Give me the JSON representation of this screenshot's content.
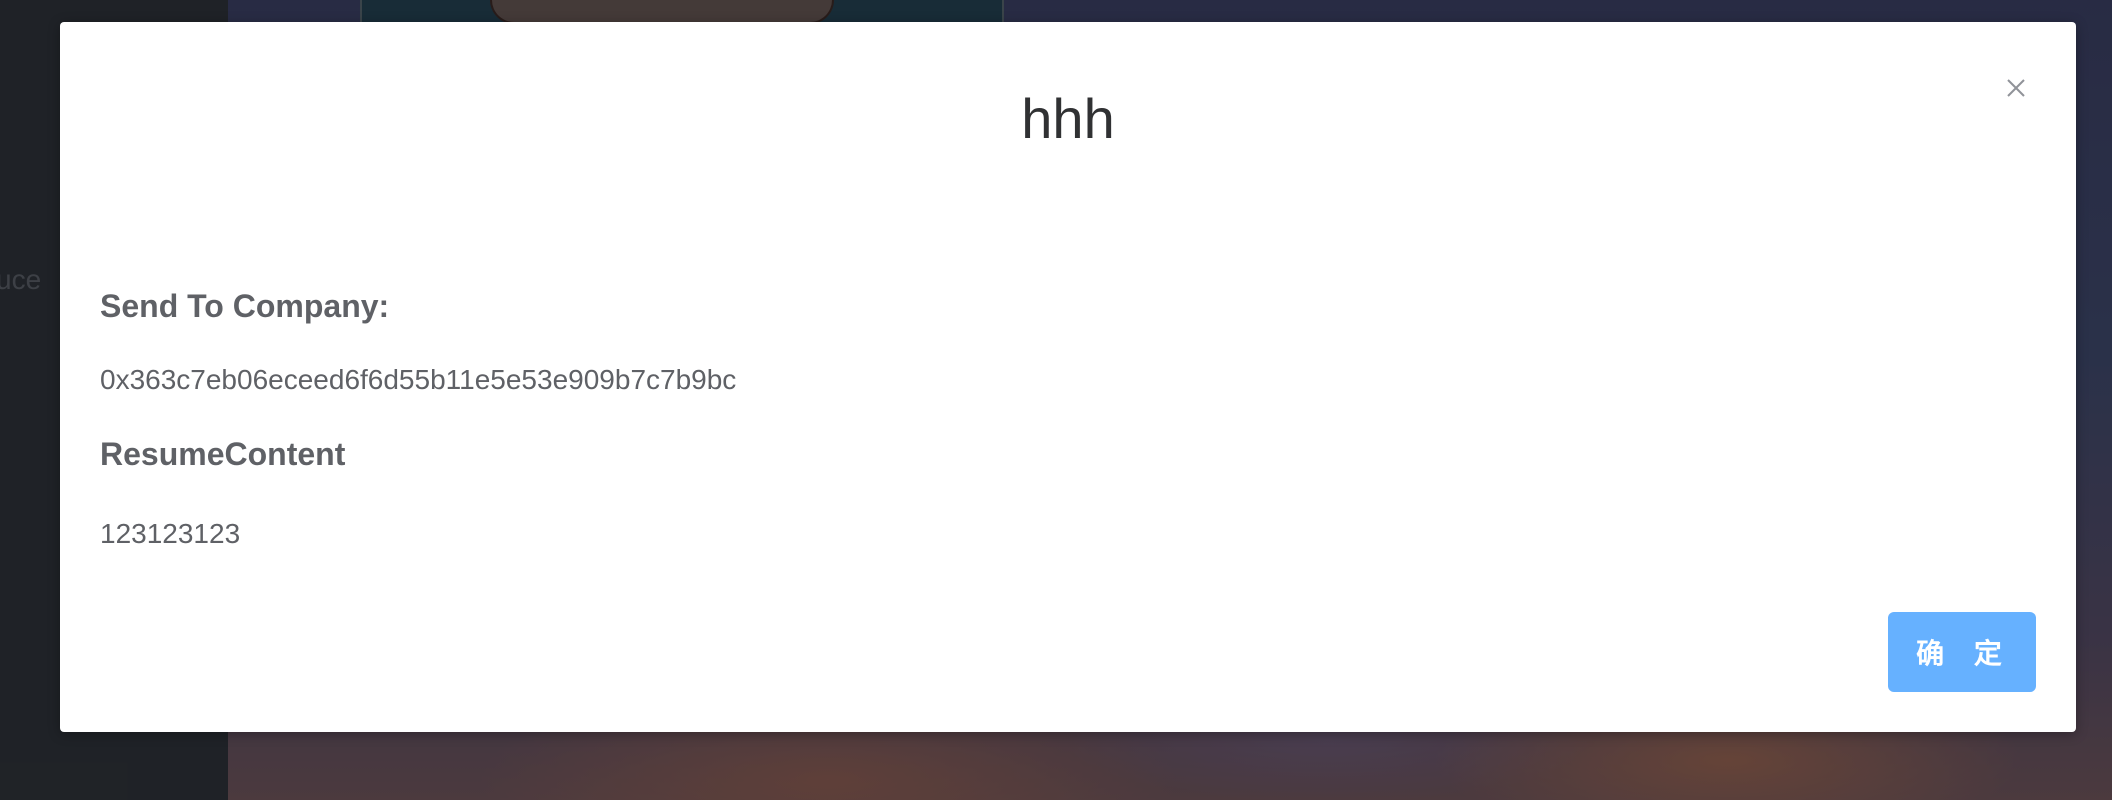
{
  "background": {
    "sidebar_partial_label": "uce"
  },
  "dialog": {
    "title": "hhh",
    "close_icon": "close-icon",
    "fields": [
      {
        "label": "Send To Company:",
        "value": "0x363c7eb06eceed6f6d55b11e5e53e909b7c7b9bc"
      },
      {
        "label": "ResumeContent",
        "value": "123123123"
      }
    ],
    "confirm_label": "确 定"
  },
  "colors": {
    "primary_button": "#66b1ff",
    "dialog_background": "#ffffff",
    "overlay": "rgba(0,0,0,0.45)",
    "text_title": "#303133",
    "text_body": "#5f6166"
  }
}
